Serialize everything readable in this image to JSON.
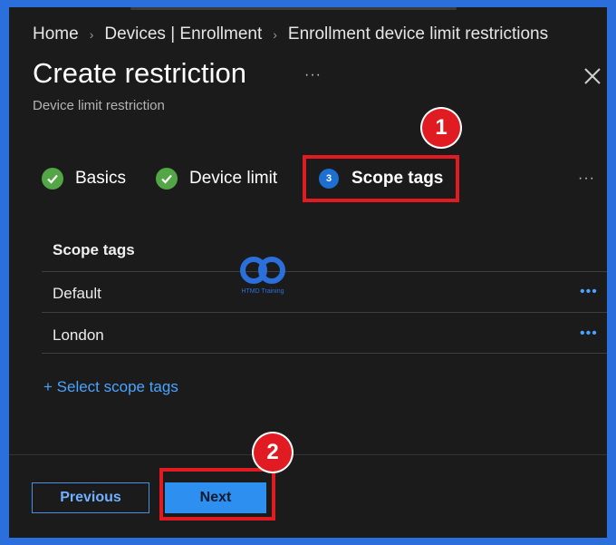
{
  "breadcrumb": {
    "items": [
      "Home",
      "Devices | Enrollment",
      "Enrollment device limit restrictions"
    ],
    "separator": "›"
  },
  "header": {
    "title": "Create restriction",
    "subtitle": "Device limit restriction",
    "more_label": "···"
  },
  "steps": [
    {
      "label": "Basics",
      "status": "complete"
    },
    {
      "label": "Device limit",
      "status": "complete"
    },
    {
      "label": "Scope tags",
      "status": "current",
      "number": "3"
    }
  ],
  "steps_more": "···",
  "table": {
    "header": "Scope tags",
    "rows": [
      {
        "name": "Default",
        "actions": "•••"
      },
      {
        "name": "London",
        "actions": "•••"
      }
    ]
  },
  "select_link": "+ Select scope tags",
  "footer": {
    "previous_label": "Previous",
    "next_label": "Next"
  },
  "annotations": {
    "callout_1": "1",
    "callout_2": "2"
  },
  "watermark": {
    "text": "HTMD Training"
  },
  "colors": {
    "background": "#1b1b1b",
    "accent": "#2d8ff0",
    "link": "#4aa3ff",
    "complete": "#53a646",
    "highlight": "#e11b22",
    "frame": "#2a6fdb"
  }
}
